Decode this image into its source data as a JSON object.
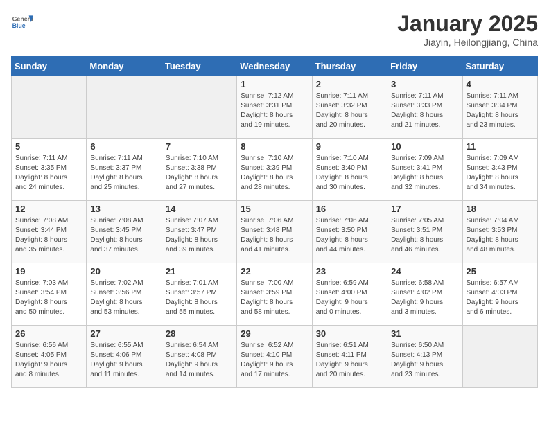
{
  "header": {
    "logo_general": "General",
    "logo_blue": "Blue",
    "title": "January 2025",
    "subtitle": "Jiayin, Heilongjiang, China"
  },
  "weekdays": [
    "Sunday",
    "Monday",
    "Tuesday",
    "Wednesday",
    "Thursday",
    "Friday",
    "Saturday"
  ],
  "weeks": [
    [
      {
        "day": "",
        "info": ""
      },
      {
        "day": "",
        "info": ""
      },
      {
        "day": "",
        "info": ""
      },
      {
        "day": "1",
        "info": "Sunrise: 7:12 AM\nSunset: 3:31 PM\nDaylight: 8 hours\nand 19 minutes."
      },
      {
        "day": "2",
        "info": "Sunrise: 7:11 AM\nSunset: 3:32 PM\nDaylight: 8 hours\nand 20 minutes."
      },
      {
        "day": "3",
        "info": "Sunrise: 7:11 AM\nSunset: 3:33 PM\nDaylight: 8 hours\nand 21 minutes."
      },
      {
        "day": "4",
        "info": "Sunrise: 7:11 AM\nSunset: 3:34 PM\nDaylight: 8 hours\nand 23 minutes."
      }
    ],
    [
      {
        "day": "5",
        "info": "Sunrise: 7:11 AM\nSunset: 3:35 PM\nDaylight: 8 hours\nand 24 minutes."
      },
      {
        "day": "6",
        "info": "Sunrise: 7:11 AM\nSunset: 3:37 PM\nDaylight: 8 hours\nand 25 minutes."
      },
      {
        "day": "7",
        "info": "Sunrise: 7:10 AM\nSunset: 3:38 PM\nDaylight: 8 hours\nand 27 minutes."
      },
      {
        "day": "8",
        "info": "Sunrise: 7:10 AM\nSunset: 3:39 PM\nDaylight: 8 hours\nand 28 minutes."
      },
      {
        "day": "9",
        "info": "Sunrise: 7:10 AM\nSunset: 3:40 PM\nDaylight: 8 hours\nand 30 minutes."
      },
      {
        "day": "10",
        "info": "Sunrise: 7:09 AM\nSunset: 3:41 PM\nDaylight: 8 hours\nand 32 minutes."
      },
      {
        "day": "11",
        "info": "Sunrise: 7:09 AM\nSunset: 3:43 PM\nDaylight: 8 hours\nand 34 minutes."
      }
    ],
    [
      {
        "day": "12",
        "info": "Sunrise: 7:08 AM\nSunset: 3:44 PM\nDaylight: 8 hours\nand 35 minutes."
      },
      {
        "day": "13",
        "info": "Sunrise: 7:08 AM\nSunset: 3:45 PM\nDaylight: 8 hours\nand 37 minutes."
      },
      {
        "day": "14",
        "info": "Sunrise: 7:07 AM\nSunset: 3:47 PM\nDaylight: 8 hours\nand 39 minutes."
      },
      {
        "day": "15",
        "info": "Sunrise: 7:06 AM\nSunset: 3:48 PM\nDaylight: 8 hours\nand 41 minutes."
      },
      {
        "day": "16",
        "info": "Sunrise: 7:06 AM\nSunset: 3:50 PM\nDaylight: 8 hours\nand 44 minutes."
      },
      {
        "day": "17",
        "info": "Sunrise: 7:05 AM\nSunset: 3:51 PM\nDaylight: 8 hours\nand 46 minutes."
      },
      {
        "day": "18",
        "info": "Sunrise: 7:04 AM\nSunset: 3:53 PM\nDaylight: 8 hours\nand 48 minutes."
      }
    ],
    [
      {
        "day": "19",
        "info": "Sunrise: 7:03 AM\nSunset: 3:54 PM\nDaylight: 8 hours\nand 50 minutes."
      },
      {
        "day": "20",
        "info": "Sunrise: 7:02 AM\nSunset: 3:56 PM\nDaylight: 8 hours\nand 53 minutes."
      },
      {
        "day": "21",
        "info": "Sunrise: 7:01 AM\nSunset: 3:57 PM\nDaylight: 8 hours\nand 55 minutes."
      },
      {
        "day": "22",
        "info": "Sunrise: 7:00 AM\nSunset: 3:59 PM\nDaylight: 8 hours\nand 58 minutes."
      },
      {
        "day": "23",
        "info": "Sunrise: 6:59 AM\nSunset: 4:00 PM\nDaylight: 9 hours\nand 0 minutes."
      },
      {
        "day": "24",
        "info": "Sunrise: 6:58 AM\nSunset: 4:02 PM\nDaylight: 9 hours\nand 3 minutes."
      },
      {
        "day": "25",
        "info": "Sunrise: 6:57 AM\nSunset: 4:03 PM\nDaylight: 9 hours\nand 6 minutes."
      }
    ],
    [
      {
        "day": "26",
        "info": "Sunrise: 6:56 AM\nSunset: 4:05 PM\nDaylight: 9 hours\nand 8 minutes."
      },
      {
        "day": "27",
        "info": "Sunrise: 6:55 AM\nSunset: 4:06 PM\nDaylight: 9 hours\nand 11 minutes."
      },
      {
        "day": "28",
        "info": "Sunrise: 6:54 AM\nSunset: 4:08 PM\nDaylight: 9 hours\nand 14 minutes."
      },
      {
        "day": "29",
        "info": "Sunrise: 6:52 AM\nSunset: 4:10 PM\nDaylight: 9 hours\nand 17 minutes."
      },
      {
        "day": "30",
        "info": "Sunrise: 6:51 AM\nSunset: 4:11 PM\nDaylight: 9 hours\nand 20 minutes."
      },
      {
        "day": "31",
        "info": "Sunrise: 6:50 AM\nSunset: 4:13 PM\nDaylight: 9 hours\nand 23 minutes."
      },
      {
        "day": "",
        "info": ""
      }
    ]
  ]
}
